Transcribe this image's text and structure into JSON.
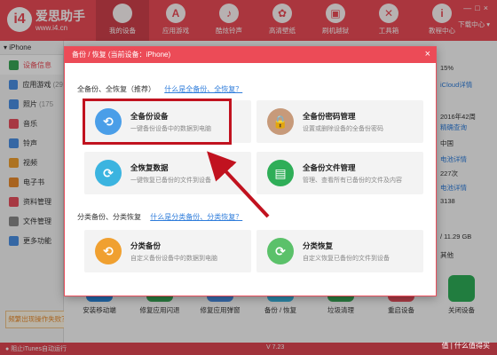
{
  "app": {
    "logo_mark": "i4",
    "title": "爱思助手",
    "subtitle": "www.i4.cn",
    "download_center": "下载中心 ▾",
    "win_controls": "—□×"
  },
  "nav": [
    {
      "label": "我的设备",
      "icon": "apple-icon",
      "glyph": ""
    },
    {
      "label": "应用游戏",
      "icon": "appstore-icon",
      "glyph": "A"
    },
    {
      "label": "酷炫铃声",
      "icon": "bell-icon",
      "glyph": "♪"
    },
    {
      "label": "高清壁纸",
      "icon": "flower-icon",
      "glyph": "✿"
    },
    {
      "label": "刷机越狱",
      "icon": "box-icon",
      "glyph": "▣"
    },
    {
      "label": "工具箱",
      "icon": "tools-icon",
      "glyph": "✕"
    },
    {
      "label": "教程中心",
      "icon": "info-icon",
      "glyph": "i"
    }
  ],
  "sidebar": {
    "device": "iPhone",
    "items": [
      {
        "label": "设备信息",
        "count": "",
        "color": "#3aa757"
      },
      {
        "label": "应用游戏",
        "count": "(29",
        "color": "#4a8fe3"
      },
      {
        "label": "照片",
        "count": "(175",
        "color": "#4a8fe3"
      },
      {
        "label": "音乐",
        "count": "",
        "color": "#e8505d"
      },
      {
        "label": "铃声",
        "count": "",
        "color": "#4a8fe3"
      },
      {
        "label": "视频",
        "count": "",
        "color": "#f0a030"
      },
      {
        "label": "电子书",
        "count": "",
        "color": "#e98b2d"
      },
      {
        "label": "资料管理",
        "count": "",
        "color": "#e8505d"
      },
      {
        "label": "文件管理",
        "count": "",
        "color": "#888888"
      },
      {
        "label": "更多功能",
        "count": "",
        "color": "#4a8fe3"
      }
    ],
    "feedback": "频繁出现操作失败？"
  },
  "background_info": {
    "rows": [
      "15%",
      "iCloud详情",
      "2016年42周",
      "精确查询",
      "中国",
      "电池详情",
      "227次",
      "电池详情",
      "3138"
    ],
    "storage": "/ 11.29 GB",
    "other": "其他"
  },
  "toolbar": [
    {
      "label": "安装移动端",
      "color": "#2c8ae0"
    },
    {
      "label": "修复应用闪退",
      "color": "#3aa757"
    },
    {
      "label": "修复应用弹窗",
      "color": "#4a8fe3"
    },
    {
      "label": "备份 / 恢复",
      "color": "#3bb4e0"
    },
    {
      "label": "垃圾清理",
      "color": "#3aa757"
    },
    {
      "label": "重启设备",
      "color": "#e8505d"
    },
    {
      "label": "关闭设备",
      "color": "#2fae58"
    }
  ],
  "status": {
    "left": "阻止iTunes自动运行",
    "version": "V 7.23",
    "watermark": "值 | 什么值得买"
  },
  "dialog": {
    "title": "备份 / 恢复   (当前设备：iPhone)",
    "close": "×",
    "section1": {
      "title": "全备份、全恢复（推荐）",
      "link": "什么是全备份、全恢复？"
    },
    "section2": {
      "title": "分类备份、分类恢复",
      "link": "什么是分类备份、分类恢复？"
    },
    "cards": [
      {
        "title": "全备份设备",
        "desc": "一键备份设备中的数据到电脑",
        "color": "#4a9ee8",
        "glyph": "⟲"
      },
      {
        "title": "全备份密码管理",
        "desc": "设置或删除设备的全备份密码",
        "color": "#c79a7a",
        "glyph": "🔒"
      },
      {
        "title": "全恢复数据",
        "desc": "一键恢复已备份的文件到设备",
        "color": "#3bb4e0",
        "glyph": "⟳"
      },
      {
        "title": "全备份文件管理",
        "desc": "管理、查看所有已备份的文件及内容",
        "color": "#2fae58",
        "glyph": "▤"
      },
      {
        "title": "分类备份",
        "desc": "自定义备份设备中的数据到电脑",
        "color": "#f0a030",
        "glyph": "⟲"
      },
      {
        "title": "分类恢复",
        "desc": "自定义恢复已备份的文件到设备",
        "color": "#5bc16a",
        "glyph": "⟳"
      }
    ]
  },
  "colors": {
    "brand": "#ec4b57",
    "highlight": "#c1121f",
    "link": "#2f7ddb"
  }
}
